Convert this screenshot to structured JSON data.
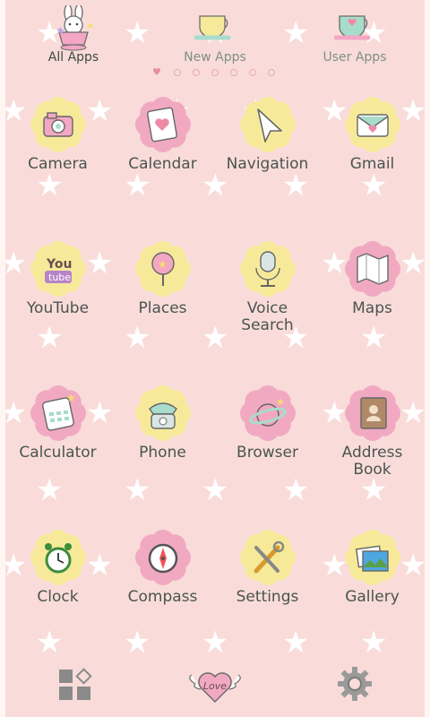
{
  "tabs": [
    {
      "label": "All Apps",
      "icon": "bunny-teacup-icon",
      "active": true
    },
    {
      "label": "New Apps",
      "icon": "teacup-icon",
      "active": false
    },
    {
      "label": "User Apps",
      "icon": "teacup-heart-icon",
      "active": false
    }
  ],
  "pager": {
    "page_count": 7,
    "current": 1
  },
  "apps": [
    {
      "label": "Camera",
      "icon": "camera-icon",
      "badge_color": "#f6ea9a"
    },
    {
      "label": "Calendar",
      "icon": "calendar-icon",
      "badge_color": "#f1a9c2"
    },
    {
      "label": "Navigation",
      "icon": "navigation-arrow-icon",
      "badge_color": "#f6ea9a"
    },
    {
      "label": "Gmail",
      "icon": "mail-icon",
      "badge_color": "#f6ea9a"
    },
    {
      "label": "YouTube",
      "icon": "youtube-icon",
      "badge_color": "#f6ea9a"
    },
    {
      "label": "Places",
      "icon": "places-pin-icon",
      "badge_color": "#f6ea9a"
    },
    {
      "label": "Voice\nSearch",
      "icon": "microphone-icon",
      "badge_color": "#f6ea9a"
    },
    {
      "label": "Maps",
      "icon": "map-icon",
      "badge_color": "#f1a9c2"
    },
    {
      "label": "Calculator",
      "icon": "calculator-icon",
      "badge_color": "#f1a9c2"
    },
    {
      "label": "Phone",
      "icon": "phone-icon",
      "badge_color": "#f6ea9a"
    },
    {
      "label": "Browser",
      "icon": "planet-icon",
      "badge_color": "#f1a9c2"
    },
    {
      "label": "Address\nBook",
      "icon": "address-book-icon",
      "badge_color": "#f1a9c2"
    },
    {
      "label": "Clock",
      "icon": "alarm-clock-icon",
      "badge_color": "#f6ea9a"
    },
    {
      "label": "Compass",
      "icon": "compass-icon",
      "badge_color": "#f1a9c2"
    },
    {
      "label": "Settings",
      "icon": "tools-icon",
      "badge_color": "#f6ea9a"
    },
    {
      "label": "Gallery",
      "icon": "gallery-icon",
      "badge_color": "#f6ea9a"
    }
  ],
  "dock": {
    "left_icon": "app-drawer-icon",
    "center_icon": "love-heart-icon",
    "center_text": "Love",
    "right_icon": "gear-icon"
  },
  "colors": {
    "background": "#f9dcd9",
    "yellow_badge": "#f6ea9a",
    "pink_badge": "#f1a9c2",
    "mint": "#a8dccb",
    "text": "#4a5450"
  }
}
